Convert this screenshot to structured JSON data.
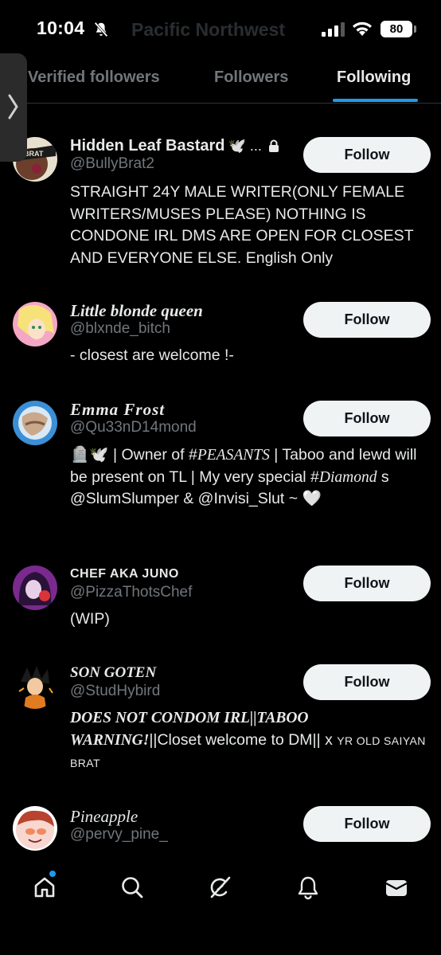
{
  "status_bar": {
    "time": "10:04",
    "ghost_title": "Pacific Northwest",
    "battery": "80"
  },
  "tabs": [
    {
      "label": "Verified followers"
    },
    {
      "label": "Followers"
    },
    {
      "label": "Following"
    }
  ],
  "active_tab": "Following",
  "accent_color": "#1d9bf0",
  "users": [
    {
      "name": "Hidden Leaf Bastard",
      "name_extra": "🕊️ ...",
      "protected": true,
      "handle": "@BullyBrat2",
      "avatar_text": "BRAT",
      "bio": "STRAIGHT 24Y MALE WRITER(ONLY FEMALE WRITERS/MUSES PLEASE) NOTHING IS CONDONE IRL DMS ARE OPEN FOR CLOSEST AND EVERYONE ELSE. English Only",
      "follow_label": "Follow"
    },
    {
      "name": "Little blonde queen",
      "handle": "@blxnde_bitch",
      "bio": "- closest are welcome !-",
      "follow_label": "Follow"
    },
    {
      "name": "Emma Frost",
      "handle": "@Qu33nD14mond",
      "bio_parts": [
        "🪦🕊️ | Owner of #",
        "PEASANTS",
        " | Taboo and lewd will be present on TL | My very special #",
        "Diamond",
        " s @SlumSlumper & @Invisi_Slut ~ 🤍"
      ],
      "follow_label": "Follow"
    },
    {
      "name": "CHEF AKA JUNO",
      "handle": "@PizzaThotsChef",
      "bio": "(WIP)",
      "follow_label": "Follow"
    },
    {
      "name": "SON GOTEN",
      "handle": "@StudHybird",
      "bio_parts": [
        "DOES NOT CONDOM IRL||TABOO WARNING!",
        "||Closet welcome to DM|| x ",
        "YR OLD SAIYAN BRAT"
      ],
      "follow_label": "Follow"
    },
    {
      "name": "Pineapple",
      "handle": "@pervy_pine_",
      "follow_label": "Follow"
    }
  ],
  "bottom_nav": [
    {
      "icon": "home-icon"
    },
    {
      "icon": "search-icon"
    },
    {
      "icon": "grok-icon"
    },
    {
      "icon": "notifications-icon"
    },
    {
      "icon": "messages-icon"
    }
  ]
}
